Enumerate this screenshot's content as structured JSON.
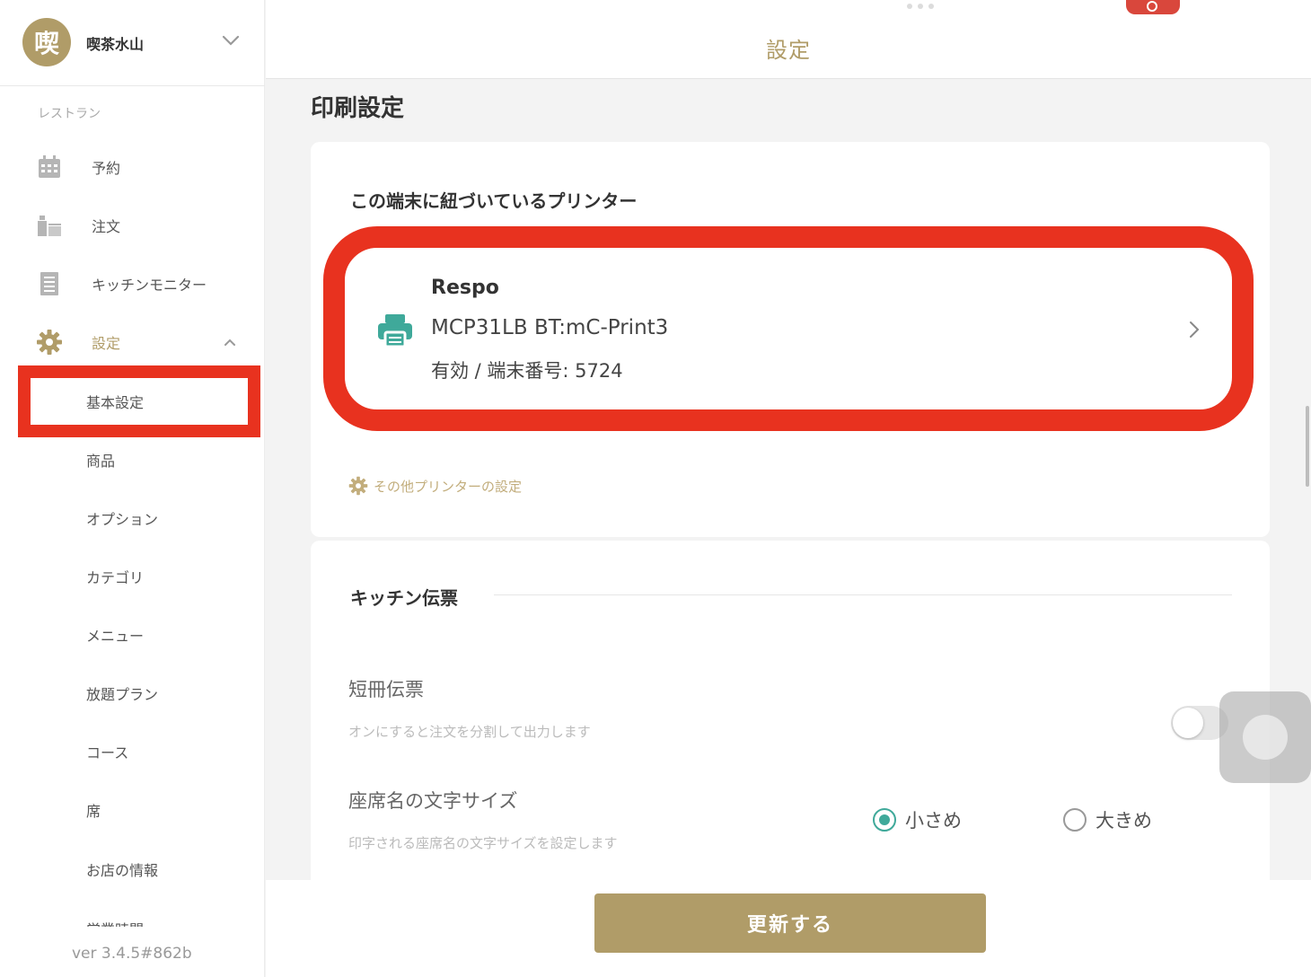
{
  "store": {
    "avatar_char": "喫",
    "name": "喫茶水山"
  },
  "sidebar": {
    "section_label": "レストラン",
    "items": [
      {
        "label": "予約"
      },
      {
        "label": "注文"
      },
      {
        "label": "キッチンモニター"
      },
      {
        "label": "設定"
      }
    ],
    "sub_items": [
      {
        "label": "基本設定"
      },
      {
        "label": "商品"
      },
      {
        "label": "オプション"
      },
      {
        "label": "カテゴリ"
      },
      {
        "label": "メニュー"
      },
      {
        "label": "放題プラン"
      },
      {
        "label": "コース"
      },
      {
        "label": "席"
      },
      {
        "label": "お店の情報"
      },
      {
        "label": "営業時間"
      }
    ],
    "version": "ver 3.4.5#862b"
  },
  "topbar": {
    "title": "設定"
  },
  "main": {
    "title": "印刷設定",
    "printers": {
      "heading": "この端末に紐づいているプリンター",
      "printer": {
        "name": "Respo",
        "model": "MCP31LB BT:mC-Print3",
        "status": "有効 / 端末番号: 5724"
      },
      "other_link": "その他プリンターの設定"
    },
    "kitchen": {
      "heading": "キッチン伝票",
      "strip_slip": {
        "title": "短冊伝票",
        "description": "オンにすると注文を分割して出力します",
        "enabled": false
      },
      "seat_font_size": {
        "title": "座席名の文字サイズ",
        "description": "印字される座席名の文字サイズを設定します",
        "options": [
          "小さめ",
          "大きめ"
        ],
        "selected": "小さめ"
      }
    }
  },
  "footer": {
    "update_label": "更新する"
  },
  "colors": {
    "brand_gold": "#b09c68",
    "highlight_red": "#e8321f",
    "printer_teal": "#3fa99a"
  }
}
